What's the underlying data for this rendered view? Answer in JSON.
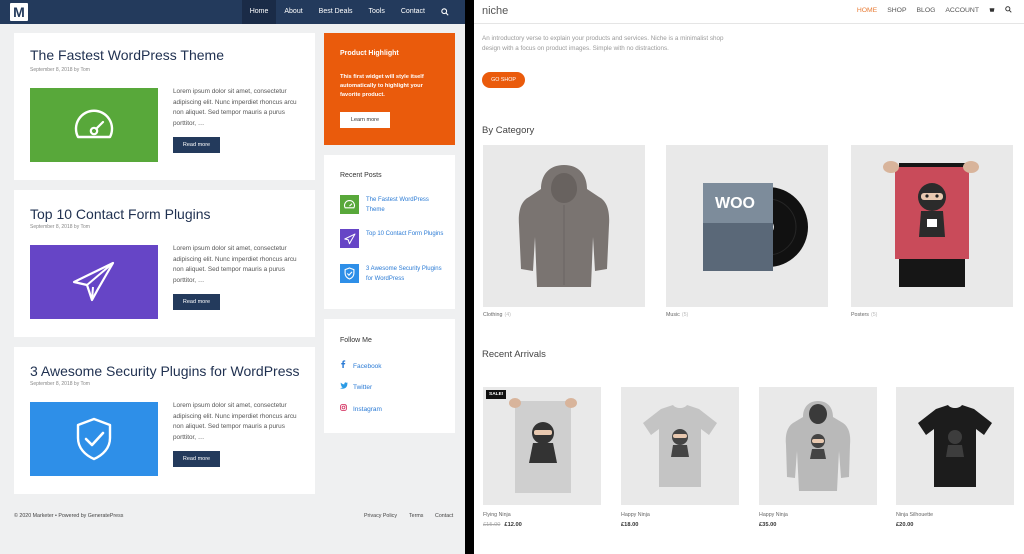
{
  "left": {
    "nav": [
      "Home",
      "About",
      "Best Deals",
      "Tools",
      "Contact"
    ],
    "logo_letter": "M",
    "posts": [
      {
        "title": "The Fastest WordPress Theme",
        "meta": "September 8, 2018 by Tom",
        "excerpt": "Lorem ipsum dolor sit amet, consectetur adipiscing elit. Nunc imperdiet rhoncus arcu non aliquet. Sed tempor mauris a purus porttitor, …",
        "button": "Read more",
        "thumb_color": "#58a83a",
        "icon": "speedometer-icon"
      },
      {
        "title": "Top 10 Contact Form Plugins",
        "meta": "September 8, 2018 by Tom",
        "excerpt": "Lorem ipsum dolor sit amet, consectetur adipiscing elit. Nunc imperdiet rhoncus arcu non aliquet. Sed tempor mauris a purus porttitor, …",
        "button": "Read more",
        "thumb_color": "#6645c6",
        "icon": "paper-plane-icon"
      },
      {
        "title": "3 Awesome Security Plugins for WordPress",
        "meta": "September 8, 2018 by Tom",
        "excerpt": "Lorem ipsum dolor sit amet, consectetur adipiscing elit. Nunc imperdiet rhoncus arcu non aliquet. Sed tempor mauris a purus porttitor, …",
        "button": "Read more",
        "thumb_color": "#2e8fe8",
        "icon": "shield-check-icon"
      }
    ],
    "highlight": {
      "title": "Product Highlight",
      "text": "This first widget will style itself automatically to highlight your favorite product.",
      "button": "Learn more"
    },
    "recent_posts": {
      "title": "Recent Posts",
      "items": [
        "The Fastest WordPress Theme",
        "Top 10 Contact Form Plugins",
        "3 Awesome Security Plugins for WordPress"
      ]
    },
    "follow": {
      "title": "Follow Me",
      "items": [
        "Facebook",
        "Twitter",
        "Instagram"
      ]
    },
    "footer": {
      "copyright": "© 2020 Marketer • Powered by GeneratePress",
      "links": [
        "Privacy Policy",
        "Terms",
        "Contact"
      ]
    }
  },
  "right": {
    "brand": "niche",
    "nav": [
      "HOME",
      "SHOP",
      "BLOG",
      "ACCOUNT"
    ],
    "intro": "An introductory verse to explain your products and services. Niche is a minimalist shop design with a focus on product images. Simple with no distractions.",
    "cta": "GO SHOP",
    "by_category": "By Category",
    "categories": [
      {
        "name": "Clothing",
        "count": "(4)"
      },
      {
        "name": "Music",
        "count": "(5)"
      },
      {
        "name": "Posters",
        "count": "(5)"
      }
    ],
    "recent_arrivals": "Recent Arrivals",
    "products": [
      {
        "name": "Flying Ninja",
        "old_price": "£15.00",
        "price": "£12.00",
        "badge": "SALE!"
      },
      {
        "name": "Happy Ninja",
        "price": "£18.00"
      },
      {
        "name": "Happy Ninja",
        "price": "£35.00"
      },
      {
        "name": "Ninja Silhouette",
        "price": "£20.00"
      }
    ]
  }
}
